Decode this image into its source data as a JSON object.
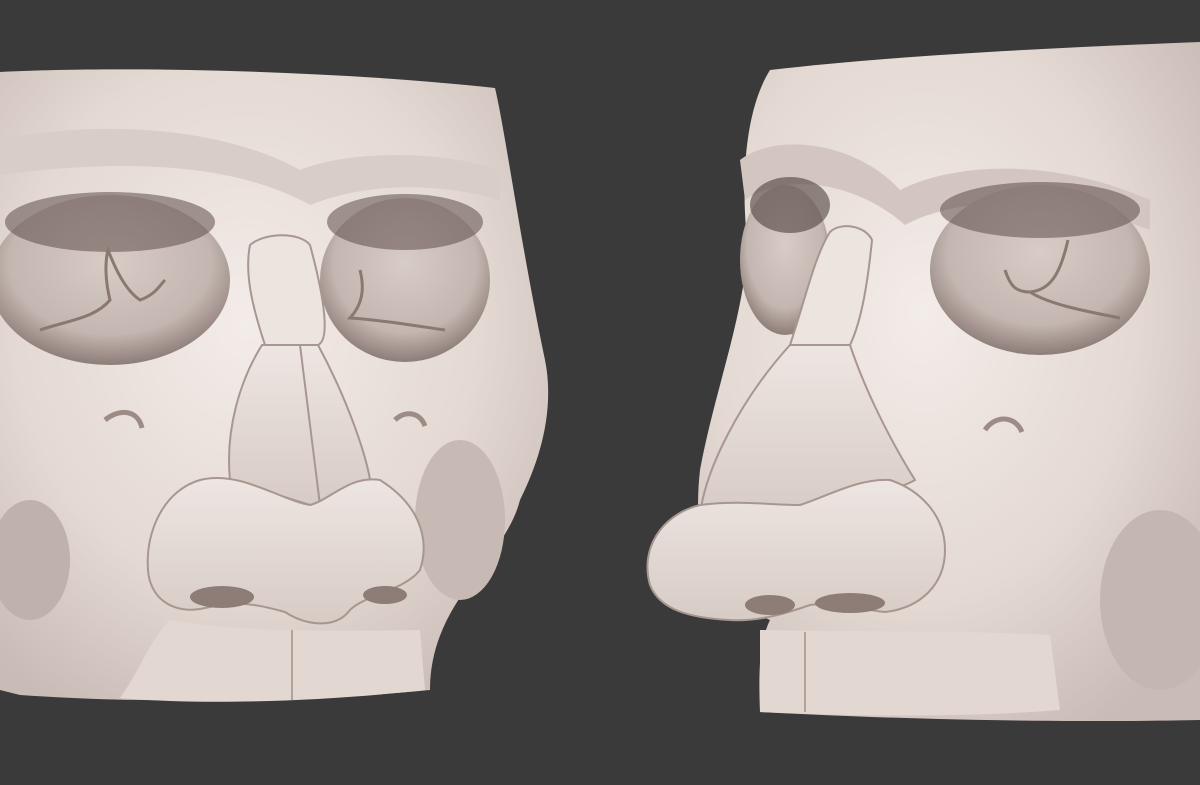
{
  "scene": {
    "background_color": "#3a3a3a",
    "material_base": "#e6dcd6",
    "material_shadow": "#b9aca6",
    "material_highlight": "#f4eeea",
    "models": [
      {
        "id": "front",
        "subject": "skull-with-nose-cartilage",
        "view": "front"
      },
      {
        "id": "three-quarter",
        "subject": "skull-with-nose-cartilage",
        "view": "three-quarter"
      }
    ]
  }
}
